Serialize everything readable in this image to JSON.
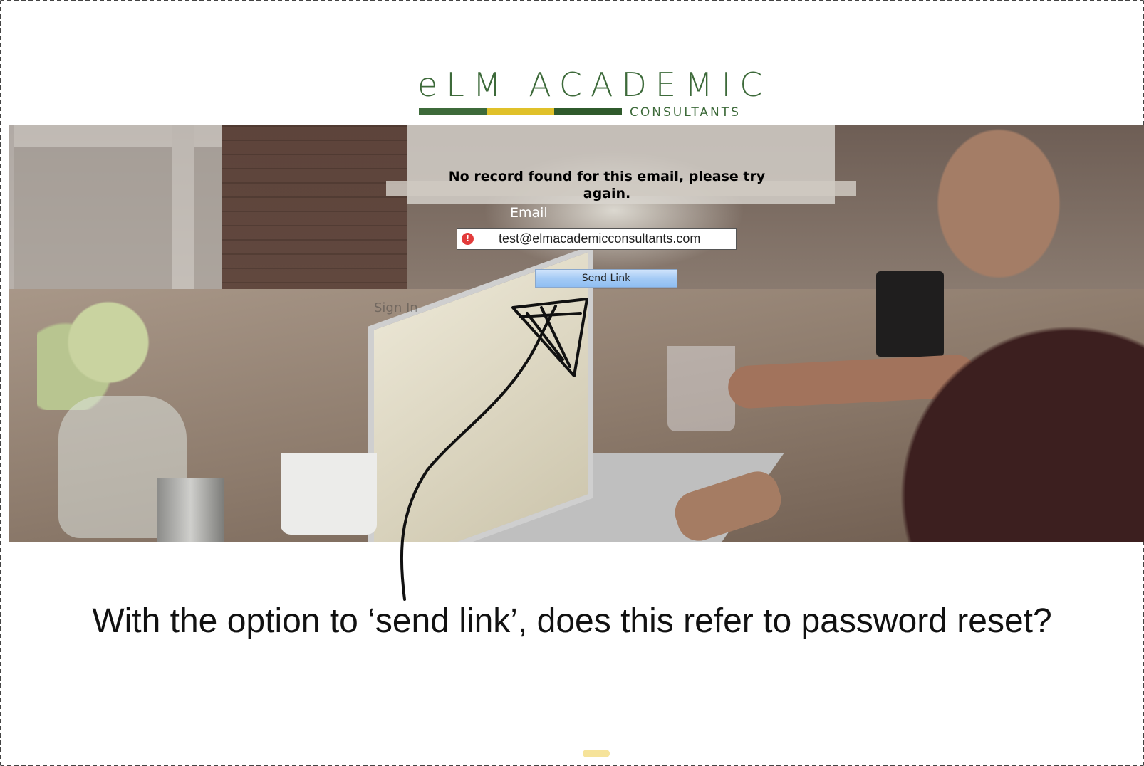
{
  "logo": {
    "wordmark": "eLM ACADEMIC",
    "subtitle": "CONSULTANTS",
    "bar_colors": [
      "#3d6a3a",
      "#e0c12a",
      "#2f5a2c"
    ]
  },
  "form": {
    "error_message": "No record found for this email, please try again.",
    "email_label": "Email",
    "email_value": "test@elmacademicconsultants.com",
    "error_icon": "!",
    "send_button_label": "Send Link",
    "sign_in_label": "Sign In"
  },
  "annotation": {
    "question": "With the option to ‘send link’, does this refer to password reset?"
  },
  "colors": {
    "brand_green": "#3d6a3a",
    "brand_yellow": "#e0c12a",
    "error_red": "#e23b3b",
    "button_blue": "#a5cbf5"
  }
}
